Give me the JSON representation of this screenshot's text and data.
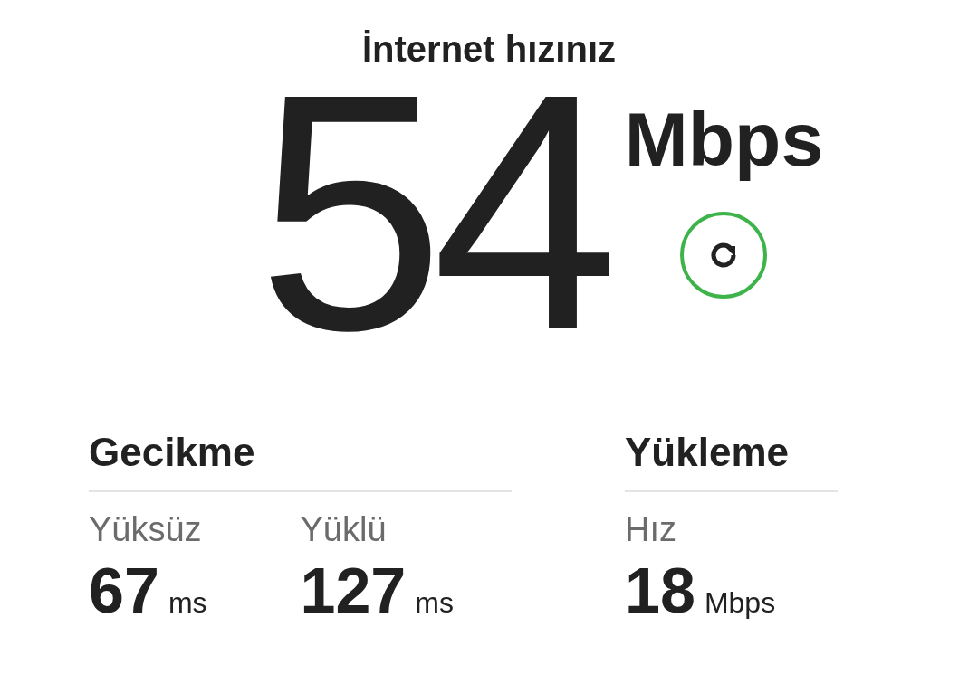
{
  "title": "İnternet hızınız",
  "speed": {
    "value": "54",
    "unit": "Mbps"
  },
  "sections": [
    {
      "heading": "Gecikme",
      "metrics": [
        {
          "label": "Yüksüz",
          "value": "67",
          "unit": "ms"
        },
        {
          "label": "Yüklü",
          "value": "127",
          "unit": "ms"
        }
      ]
    },
    {
      "heading": "Yükleme",
      "metrics": [
        {
          "label": "Hız",
          "value": "18",
          "unit": "Mbps"
        }
      ]
    }
  ]
}
